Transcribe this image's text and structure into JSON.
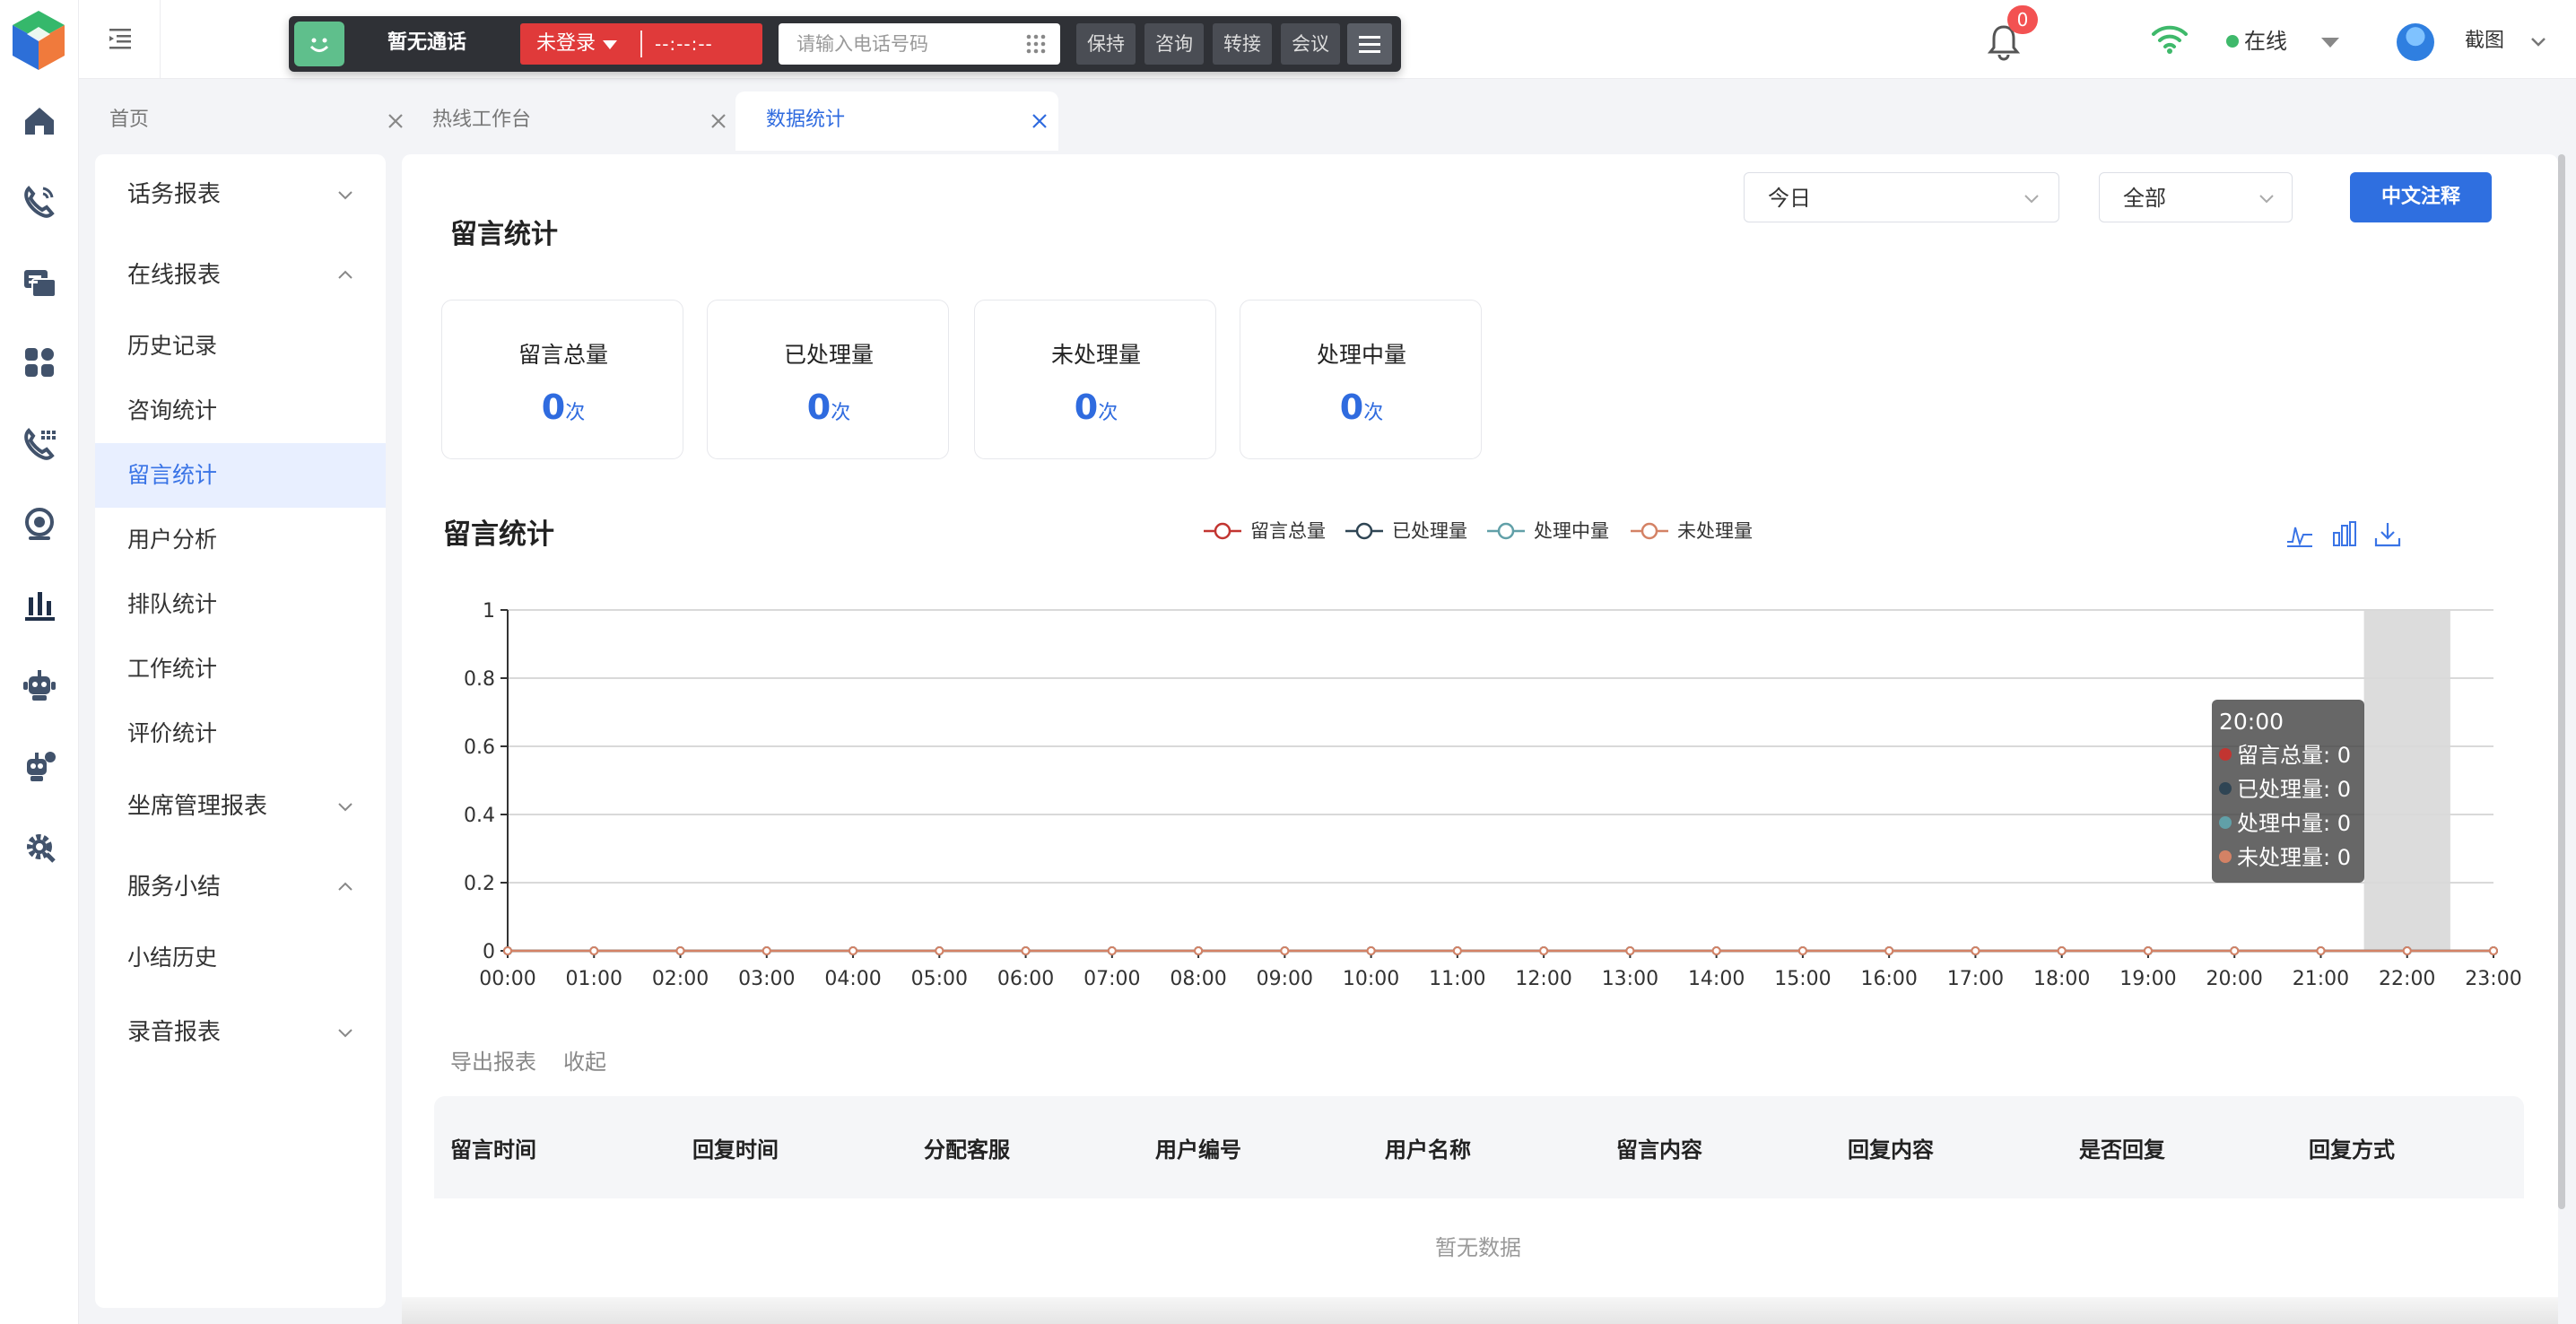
{
  "rail": {
    "icons": [
      "home-icon",
      "call-icon",
      "chat-icon",
      "apps-icon",
      "hotline-icon",
      "monitor-icon",
      "chart-icon",
      "robot-icon",
      "robot-service-icon",
      "settings-icon"
    ]
  },
  "softphone": {
    "status": "暂无通话",
    "login_label": "未登录",
    "timer": "--:--:--",
    "phone_placeholder": "请输入电话号码",
    "buttons": [
      "保持",
      "咨询",
      "转接",
      "会议"
    ]
  },
  "header": {
    "notification_count": "0",
    "online_status": "在线",
    "username": "截图"
  },
  "tabs": [
    {
      "label": "首页"
    },
    {
      "label": "热线工作台"
    },
    {
      "label": "数据统计"
    }
  ],
  "sidebar": {
    "groups": [
      {
        "label": "话务报表",
        "expanded": false
      },
      {
        "label": "在线报表",
        "expanded": true
      },
      {
        "label": "坐席管理报表",
        "expanded": false
      },
      {
        "label": "服务小结",
        "expanded": true
      },
      {
        "label": "录音报表",
        "expanded": false
      }
    ],
    "online_items": [
      "历史记录",
      "咨询统计",
      "留言统计",
      "用户分析",
      "排队统计",
      "工作统计",
      "评价统计"
    ],
    "summary_items": [
      "小结历史"
    ],
    "active_item": "留言统计"
  },
  "page": {
    "title": "留言统计",
    "filter_period": "今日",
    "filter_scope": "全部",
    "annotate_button": "中文注释"
  },
  "stats": [
    {
      "label": "留言总量",
      "value": "0",
      "unit": "次"
    },
    {
      "label": "已处理量",
      "value": "0",
      "unit": "次"
    },
    {
      "label": "未处理量",
      "value": "0",
      "unit": "次"
    },
    {
      "label": "处理中量",
      "value": "0",
      "unit": "次"
    }
  ],
  "colors": {
    "accent": "#2f6fe0",
    "total": "#c23531",
    "processed": "#2f4554",
    "processing": "#61a0a8",
    "unprocessed": "#d48265"
  },
  "chart_data": {
    "type": "line",
    "title": "留言统计",
    "x": [
      "00:00",
      "01:00",
      "02:00",
      "03:00",
      "04:00",
      "05:00",
      "06:00",
      "07:00",
      "08:00",
      "09:00",
      "10:00",
      "11:00",
      "12:00",
      "13:00",
      "14:00",
      "15:00",
      "16:00",
      "17:00",
      "18:00",
      "19:00",
      "20:00",
      "21:00",
      "22:00",
      "23:00"
    ],
    "series": [
      {
        "name": "留言总量",
        "color": "#c23531",
        "values": [
          0,
          0,
          0,
          0,
          0,
          0,
          0,
          0,
          0,
          0,
          0,
          0,
          0,
          0,
          0,
          0,
          0,
          0,
          0,
          0,
          0,
          0,
          0,
          0
        ]
      },
      {
        "name": "已处理量",
        "color": "#2f4554",
        "values": [
          0,
          0,
          0,
          0,
          0,
          0,
          0,
          0,
          0,
          0,
          0,
          0,
          0,
          0,
          0,
          0,
          0,
          0,
          0,
          0,
          0,
          0,
          0,
          0
        ]
      },
      {
        "name": "处理中量",
        "color": "#61a0a8",
        "values": [
          0,
          0,
          0,
          0,
          0,
          0,
          0,
          0,
          0,
          0,
          0,
          0,
          0,
          0,
          0,
          0,
          0,
          0,
          0,
          0,
          0,
          0,
          0,
          0
        ]
      },
      {
        "name": "未处理量",
        "color": "#d48265",
        "values": [
          0,
          0,
          0,
          0,
          0,
          0,
          0,
          0,
          0,
          0,
          0,
          0,
          0,
          0,
          0,
          0,
          0,
          0,
          0,
          0,
          0,
          0,
          0,
          0
        ]
      }
    ],
    "y_ticks": [
      "0",
      "0.2",
      "0.4",
      "0.6",
      "0.8",
      "1"
    ],
    "ylim": [
      0,
      1
    ],
    "grid": true,
    "legend_position": "top-center",
    "highlighted_category": "22:00"
  },
  "tooltip": {
    "time": "20:00",
    "rows": [
      {
        "text": "留言总量: 0",
        "color": "#c23531"
      },
      {
        "text": "已处理量: 0",
        "color": "#2f4554"
      },
      {
        "text": "处理中量: 0",
        "color": "#61a0a8"
      },
      {
        "text": "未处理量: 0",
        "color": "#d48265"
      }
    ]
  },
  "table": {
    "actions": [
      "导出报表",
      "收起"
    ],
    "columns": [
      "留言时间",
      "回复时间",
      "分配客服",
      "用户编号",
      "用户名称",
      "留言内容",
      "回复内容",
      "是否回复",
      "回复方式"
    ],
    "empty_text": "暂无数据"
  }
}
